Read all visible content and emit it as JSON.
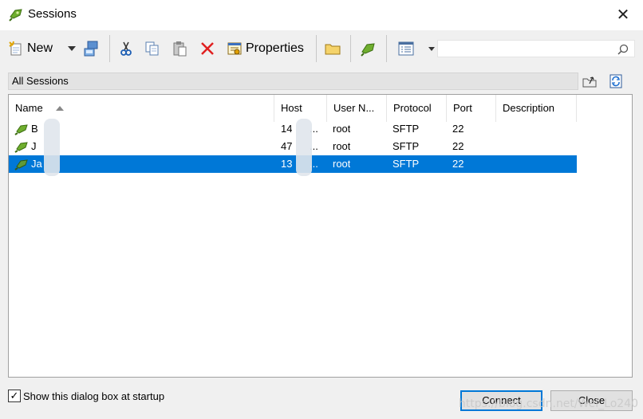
{
  "window": {
    "title": "Sessions",
    "close_glyph": "✕"
  },
  "toolbar": {
    "new_label": "New",
    "properties_label": "Properties",
    "search": {
      "value": "",
      "placeholder": ""
    }
  },
  "path": {
    "label": "All Sessions"
  },
  "columns": [
    "Name",
    "Host",
    "User N...",
    "Protocol",
    "Port",
    "Description"
  ],
  "sessions": [
    {
      "name": "B",
      "host": "14",
      "ellipsis": "...",
      "user": "root",
      "protocol": "SFTP",
      "port": "22",
      "description": "",
      "selected": false
    },
    {
      "name": "J",
      "host": "47",
      "ellipsis": "...",
      "user": "root",
      "protocol": "SFTP",
      "port": "22",
      "description": "",
      "selected": false
    },
    {
      "name": "Ja",
      "host": "13",
      "ellipsis": "...",
      "user": "root",
      "protocol": "SFTP",
      "port": "22",
      "description": "",
      "selected": true
    }
  ],
  "footer": {
    "show_at_startup_label": "Show this dialog box at startup",
    "show_at_startup_checked": true,
    "connect_label": "Connect",
    "close_label": "Close",
    "watermark": "https://blog.csdn.net/Wei_Lo240"
  },
  "colors": {
    "selection": "#0078d7",
    "window_bg": "#f0f0f0",
    "delete_red": "#e02020"
  },
  "icons": [
    "session-icon",
    "new-session-icon",
    "dropdown-arrow-icon",
    "connect-icon",
    "cut-icon",
    "copy-icon",
    "paste-icon",
    "delete-icon",
    "properties-icon",
    "folder-icon",
    "session-green-icon",
    "view-icon",
    "search-icon",
    "folder-up-icon",
    "refresh-icon"
  ]
}
